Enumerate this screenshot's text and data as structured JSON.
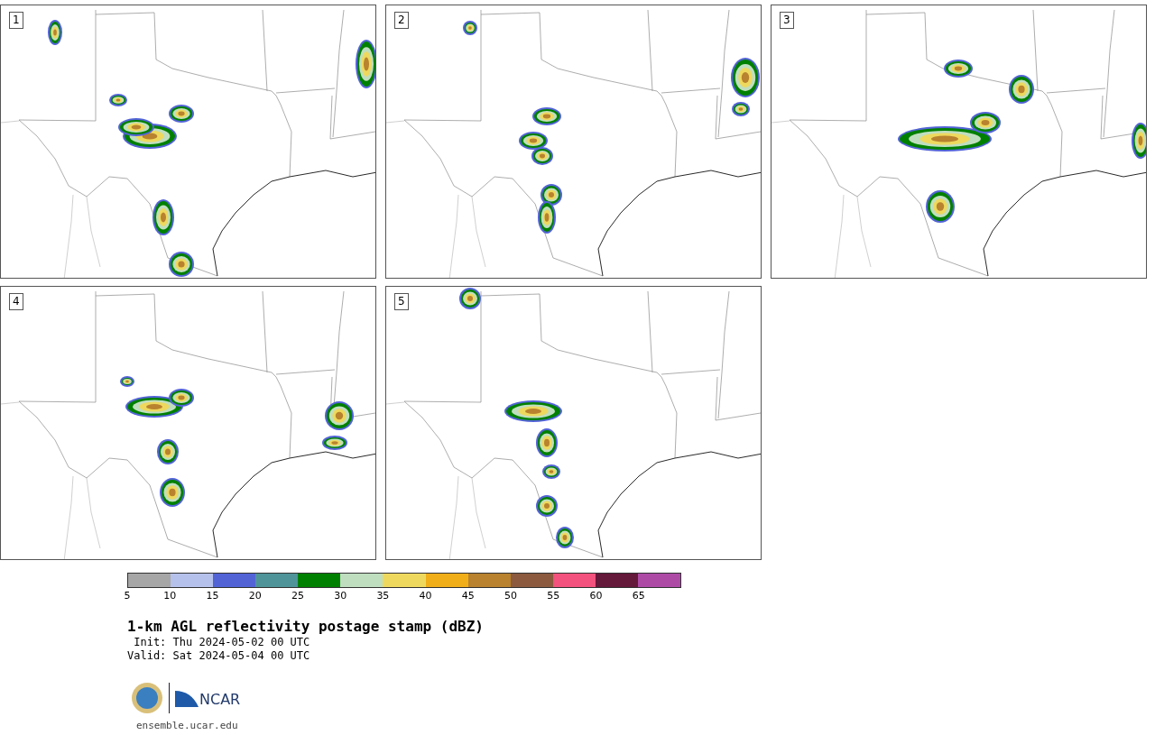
{
  "panels": [
    {
      "label": "1"
    },
    {
      "label": "2"
    },
    {
      "label": "3"
    },
    {
      "label": "4"
    },
    {
      "label": "5"
    }
  ],
  "colorbar": {
    "segments": [
      {
        "color": "#a6a6a6"
      },
      {
        "color": "#b6c1eb"
      },
      {
        "color": "#5263d6"
      },
      {
        "color": "#4f9499"
      },
      {
        "color": "#008000"
      },
      {
        "color": "#bfdebf"
      },
      {
        "color": "#eed95e"
      },
      {
        "color": "#f0ae19"
      },
      {
        "color": "#b8822e"
      },
      {
        "color": "#8b5a3f"
      },
      {
        "color": "#f2527d"
      },
      {
        "color": "#64183a"
      },
      {
        "color": "#ad4aa6"
      }
    ],
    "ticks": [
      "5",
      "10",
      "15",
      "20",
      "25",
      "30",
      "35",
      "40",
      "45",
      "50",
      "55",
      "60",
      "65"
    ]
  },
  "title": "1-km AGL reflectivity postage stamp (dBZ)",
  "init": " Init: Thu 2024-05-02 00 UTC",
  "valid": "Valid: Sat 2024-05-04 00 UTC",
  "logo": {
    "wordmark": "NCAR"
  },
  "url": "ensemble.ucar.edu"
}
